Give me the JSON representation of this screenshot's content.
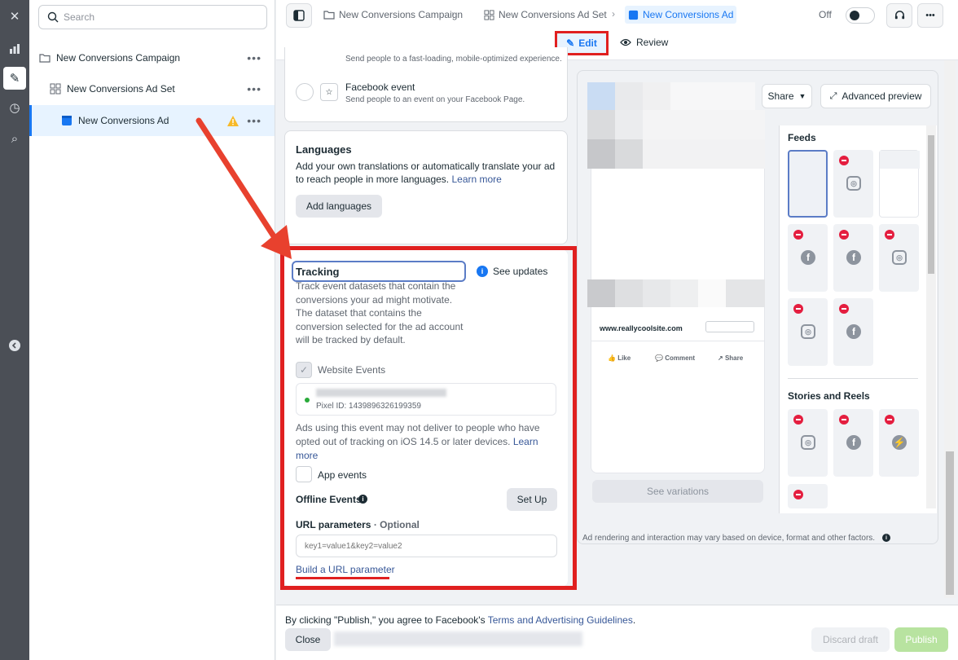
{
  "sidebar": {
    "search_placeholder": "Search",
    "items": [
      {
        "label": "New Conversions Campaign"
      },
      {
        "label": "New Conversions Ad Set"
      },
      {
        "label": "New Conversions Ad"
      }
    ],
    "more": "•••"
  },
  "breadcrumbs": [
    {
      "label": "New Conversions Campaign"
    },
    {
      "label": "New Conversions Ad Set"
    },
    {
      "label": "New Conversions Ad"
    }
  ],
  "toggle_label": "Off",
  "more_label": "•••",
  "tabs": {
    "edit": "Edit",
    "review": "Review"
  },
  "destination": {
    "top_desc": "Send people to a fast-loading, mobile-optimized experience.",
    "fb_event_title": "Facebook event",
    "fb_event_desc": "Send people to an event on your Facebook Page."
  },
  "languages": {
    "title": "Languages",
    "desc": "Add your own translations or automatically translate your ad to reach people in more languages.",
    "learn_more": "Learn more",
    "button": "Add languages"
  },
  "tracking": {
    "title": "Tracking",
    "see_updates": "See updates",
    "desc": "Track event datasets that contain the conversions your ad might motivate. The dataset that contains the conversion selected for the ad account will be tracked by default.",
    "website_events": "Website Events",
    "pixel_id": "Pixel ID: 1439896326199359",
    "ios_notice": "Ads using this event may not deliver to people who have opted out of tracking on iOS 14.5 or later devices.",
    "ios_learn": "Learn more",
    "app_events": "App events",
    "offline_events": "Offline Events",
    "setup_button": "Set Up",
    "url_params_label": "URL parameters",
    "url_params_optional": "· Optional",
    "url_params_placeholder": "key1=value1&key2=value2",
    "build_url": "Build a URL parameter"
  },
  "preview": {
    "share_button": "Share",
    "advanced_preview": "Advanced preview",
    "site": "www.reallycoolsite.com",
    "like": "Like",
    "comment": "Comment",
    "share": "Share",
    "see_variations": "See variations",
    "feeds_title": "Feeds",
    "stories_title": "Stories and Reels",
    "disclaimer": "Ad rendering and interaction may vary based on device, format and other factors."
  },
  "footer": {
    "terms_prefix": "By clicking \"Publish,\" you agree to Facebook's",
    "terms_link": "Terms and Advertising Guidelines",
    "terms_suffix": ".",
    "close": "Close",
    "discard": "Discard draft",
    "publish": "Publish"
  },
  "colors": {
    "accent": "#1877f2",
    "highlight": "#e02020",
    "publish": "#b8e3a0"
  }
}
